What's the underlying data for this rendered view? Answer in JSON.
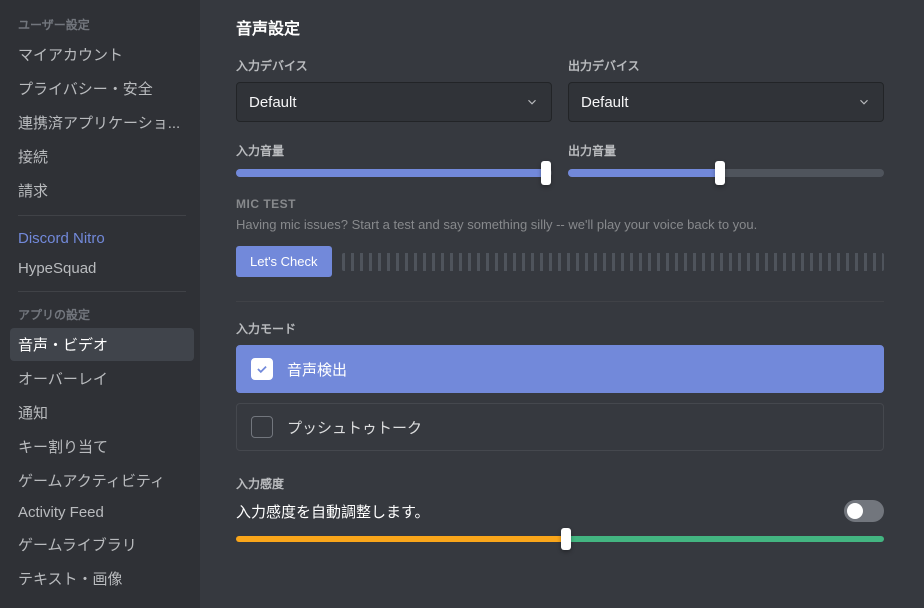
{
  "sidebar": {
    "user_settings_header": "ユーザー設定",
    "user_items": [
      "マイアカウント",
      "プライバシー・安全",
      "連携済アプリケーショ...",
      "接続",
      "請求"
    ],
    "nitro": "Discord Nitro",
    "hypesquad": "HypeSquad",
    "app_settings_header": "アプリの設定",
    "app_items": [
      "音声・ビデオ",
      "オーバーレイ",
      "通知",
      "キー割り当て",
      "ゲームアクティビティ",
      "Activity Feed",
      "ゲームライブラリ",
      "テキスト・画像"
    ],
    "active_index": 0
  },
  "page": {
    "title": "音声設定",
    "input_device_label": "入力デバイス",
    "output_device_label": "出力デバイス",
    "input_device_value": "Default",
    "output_device_value": "Default",
    "input_volume_label": "入力音量",
    "output_volume_label": "出力音量",
    "input_volume_pct": 98,
    "output_volume_pct": 48,
    "mic_test_label": "MIC TEST",
    "mic_test_desc": "Having mic issues? Start a test and say something silly -- we'll play your voice back to you.",
    "lets_check": "Let's Check",
    "input_mode_label": "入力モード",
    "mode_voice": "音声検出",
    "mode_ptt": "プッシュトゥトーク",
    "selected_mode": 0,
    "sensitivity_label": "入力感度",
    "sensitivity_auto": "入力感度を自動調整します。",
    "sensitivity_pct": 51,
    "auto_toggle": false
  },
  "colors": {
    "accent": "#7289da",
    "warn": "#faa61a",
    "ok": "#43b581"
  }
}
